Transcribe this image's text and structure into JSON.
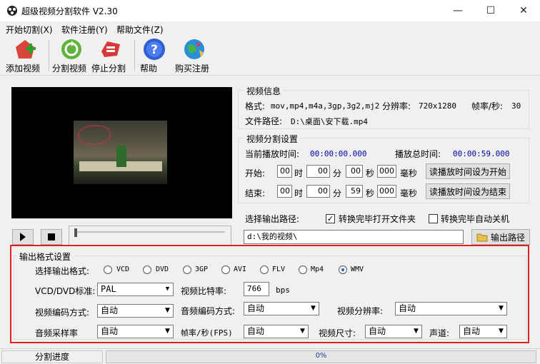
{
  "window": {
    "title": "超级视频分割软件 V2.30",
    "minimize": "—",
    "maximize": "☐",
    "close": "✕"
  },
  "menu": [
    "开始切割(X)",
    "软件注册(Y)",
    "帮助文件(Z)"
  ],
  "toolbar": {
    "add_video": "添加视频",
    "split_video": "分割视频",
    "stop_split": "停止分割",
    "help": "帮助",
    "buy": "购买注册"
  },
  "video_info": {
    "title": "视频信息",
    "format_label": "格式:",
    "format_value": "mov,mp4,m4a,3gp,3g2,mj2",
    "resolution_label": "分辨率:",
    "resolution_value": "720x1280",
    "fps_label": "帧率/秒:",
    "fps_value": "30",
    "path_label": "文件路径:",
    "path_value": "D:\\桌面\\安下载.mp4"
  },
  "split_settings": {
    "title": "视频分割设置",
    "current_time_label": "当前播放时间:",
    "current_time_value": "00:00:00.000",
    "total_time_label": "播放总时间:",
    "total_time_value": "00:00:59.000",
    "start_label": "开始:",
    "end_label": "结束:",
    "hour_unit": "时",
    "minute_unit": "分",
    "second_unit": "秒",
    "ms_unit": "毫秒",
    "start": {
      "h": "00",
      "m": "00",
      "s": "00",
      "ms": "000"
    },
    "end": {
      "h": "00",
      "m": "00",
      "s": "59",
      "ms": "000"
    },
    "set_start_button": "读播放时间设为开始",
    "set_end_button": "读播放时间设为结束"
  },
  "output_path": {
    "label": "选择输出路径:",
    "open_folder_label": "转换完毕打开文件夹",
    "open_folder_checked": true,
    "shutdown_label": "转换完毕自动关机",
    "shutdown_checked": false,
    "path_value": "d:\\我的视频\\",
    "button": "输出路径"
  },
  "output_format": {
    "title": "输出格式设置",
    "select_label": "选择输出格式:",
    "formats": [
      "VCD",
      "DVD",
      "3GP",
      "AVI",
      "FLV",
      "Mp4",
      "WMV"
    ],
    "selected": "WMV",
    "standard_label": "VCD/DVD标准:",
    "standard_value": "PAL",
    "bitrate_label": "视频比特率:",
    "bitrate_value": "766",
    "bitrate_unit": "bps",
    "video_codec_label": "视频编码方式:",
    "video_codec_value": "自动",
    "audio_codec_label": "音频编码方式:",
    "audio_codec_value": "自动",
    "resolution_label": "视频分辨率:",
    "resolution_value": "自动",
    "sample_rate_label": "音频采样率",
    "sample_rate_value": "自动",
    "fps_label": "帧率/秒(FPS)",
    "fps_value": "自动",
    "size_label": "视频尺寸:",
    "size_value": "自动",
    "channel_label": "声道:",
    "channel_value": "自动"
  },
  "status": {
    "label": "分割进度",
    "progress_text": "0%",
    "progress_fraction": 0.0
  },
  "icons": {
    "play": "play-icon",
    "stop": "stop-icon",
    "dropdown": "chevron-down-icon",
    "checkmark": "✓"
  },
  "colors": {
    "highlight_border": "#e02020",
    "time_text": "#0000b0"
  }
}
